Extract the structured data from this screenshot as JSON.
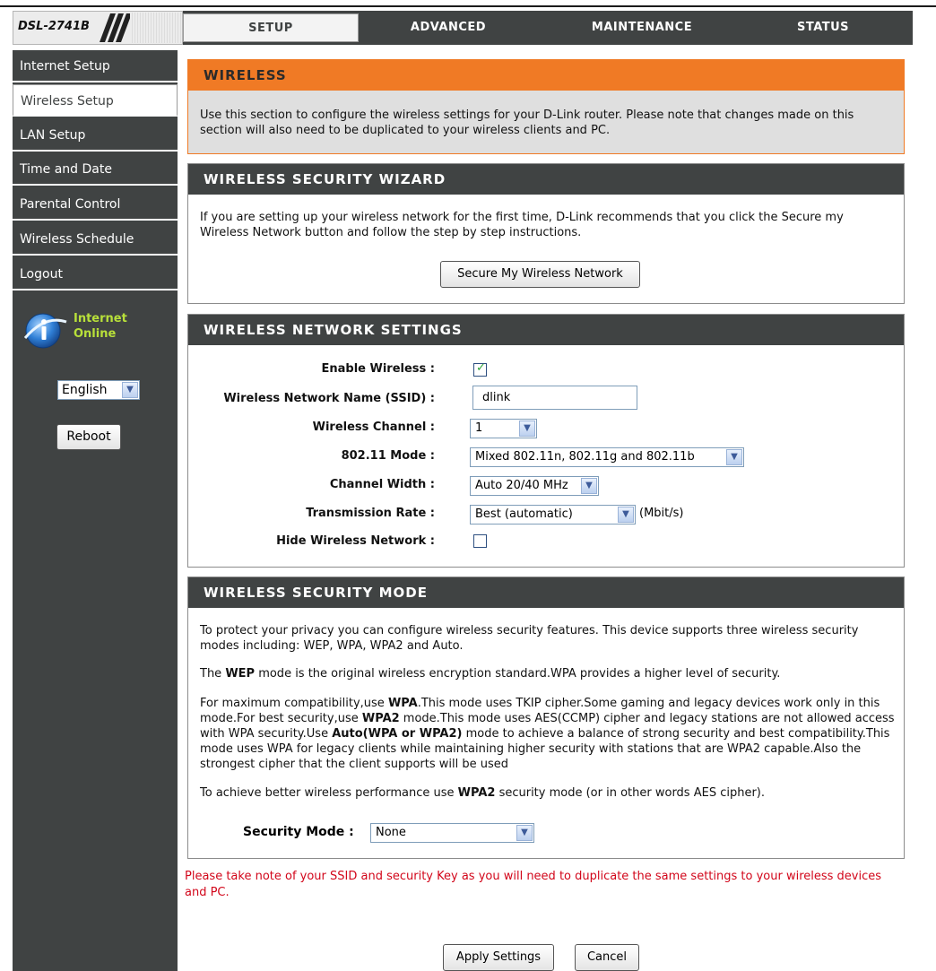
{
  "header": {
    "model": "DSL-2741B",
    "tabs": [
      "SETUP",
      "ADVANCED",
      "MAINTENANCE",
      "STATUS"
    ],
    "active_tab": "SETUP"
  },
  "sidebar": {
    "items": [
      "Internet Setup",
      "Wireless Setup",
      "LAN Setup",
      "Time and Date",
      "Parental Control",
      "Wireless Schedule",
      "Logout"
    ],
    "active_item": "Wireless Setup",
    "status_line1": "Internet",
    "status_line2": "Online",
    "language": "English",
    "reboot_label": "Reboot"
  },
  "wireless": {
    "title": "WIRELESS",
    "desc": "Use this section to configure the wireless settings for your D-Link router. Please note that changes made on this section will also need to be duplicated to your wireless clients and PC."
  },
  "wizard": {
    "title": "WIRELESS SECURITY WIZARD",
    "desc": "If you are setting up your wireless network for the first time, D-Link recommends that you click the Secure my Wireless Network button and follow the step by step instructions.",
    "button": "Secure My Wireless Network"
  },
  "network_settings": {
    "title": "WIRELESS NETWORK SETTINGS",
    "enable_wireless_label": "Enable Wireless :",
    "enable_wireless_checked": true,
    "ssid_label": "Wireless Network Name (SSID) :",
    "ssid_value": "dlink",
    "channel_label": "Wireless Channel :",
    "channel_value": "1",
    "mode_label": "802.11 Mode :",
    "mode_value": "Mixed 802.11n, 802.11g and 802.11b",
    "width_label": "Channel Width :",
    "width_value": "Auto 20/40 MHz",
    "rate_label": "Transmission Rate :",
    "rate_value": "Best (automatic)",
    "rate_unit": "(Mbit/s)",
    "hide_label": "Hide Wireless Network :",
    "hide_checked": false
  },
  "security_mode": {
    "title": "WIRELESS SECURITY MODE",
    "p1": "To protect your privacy you can configure wireless security features. This device supports three wireless security modes including: WEP, WPA, WPA2 and Auto.",
    "p2_pre": "The ",
    "p2_b1": "WEP",
    "p2_post": " mode is the original wireless encryption standard.WPA provides a higher level of security.",
    "p3_a": "For maximum compatibility,use ",
    "p3_b1": "WPA",
    "p3_c": ".This mode uses TKIP cipher.Some gaming and legacy devices work only in this mode.For best security,use ",
    "p3_b2": "WPA2",
    "p3_d": " mode.This mode uses AES(CCMP) cipher and legacy stations are not allowed access with WPA security.Use ",
    "p3_b3": "Auto(WPA or WPA2)",
    "p3_e": " mode to achieve a balance of strong security and best compatibility.This mode uses WPA for legacy clients while maintaining higher security with stations that are WPA2 capable.Also the strongest cipher that the client supports will be used",
    "p4_pre": "To achieve better wireless performance use ",
    "p4_b": "WPA2",
    "p4_post": " security mode (or in other words AES cipher).",
    "mode_label": "Security Mode :",
    "mode_value": "None"
  },
  "footer": {
    "note": "Please take note of your SSID and security Key as you will need to duplicate the same settings to your wireless devices and PC.",
    "apply": "Apply Settings",
    "cancel": "Cancel"
  },
  "colors": {
    "dark_gray": "#404343",
    "orange": "#f07a25",
    "alert_red": "#d2061a",
    "status_green": "#b8e03a"
  }
}
